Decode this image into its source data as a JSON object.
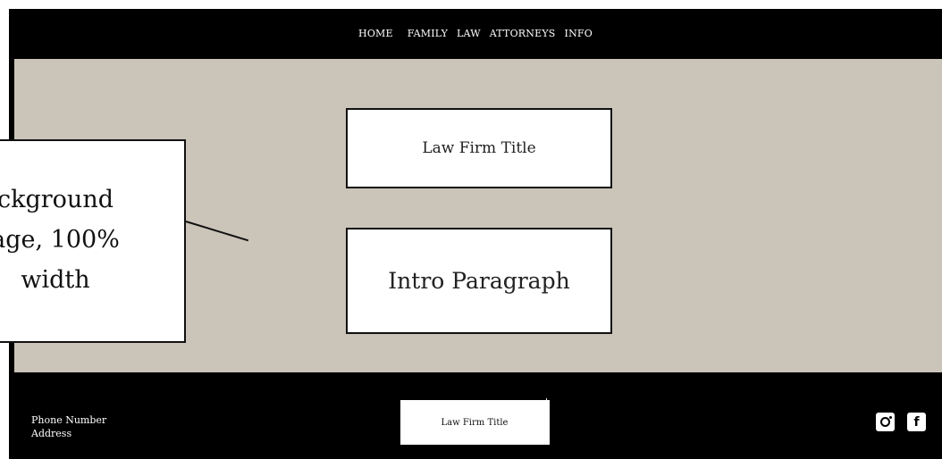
{
  "nav": {
    "items": [
      "HOME",
      "FAMILY",
      "LAW",
      "ATTORNEYS",
      "INFO"
    ]
  },
  "hero": {
    "title_box": "Law Firm Title",
    "intro_box": "Intro Paragraph"
  },
  "callout": {
    "lines": [
      "ckground",
      "age, 100%",
      "width"
    ]
  },
  "footer": {
    "phone": "Phone Number",
    "address": "Address",
    "title": "Law Firm Title",
    "social": [
      "instagram-icon",
      "facebook-icon"
    ]
  },
  "colors": {
    "hero_background": "#cbc4b9",
    "bars": "#000000",
    "boxes": "#ffffff"
  }
}
